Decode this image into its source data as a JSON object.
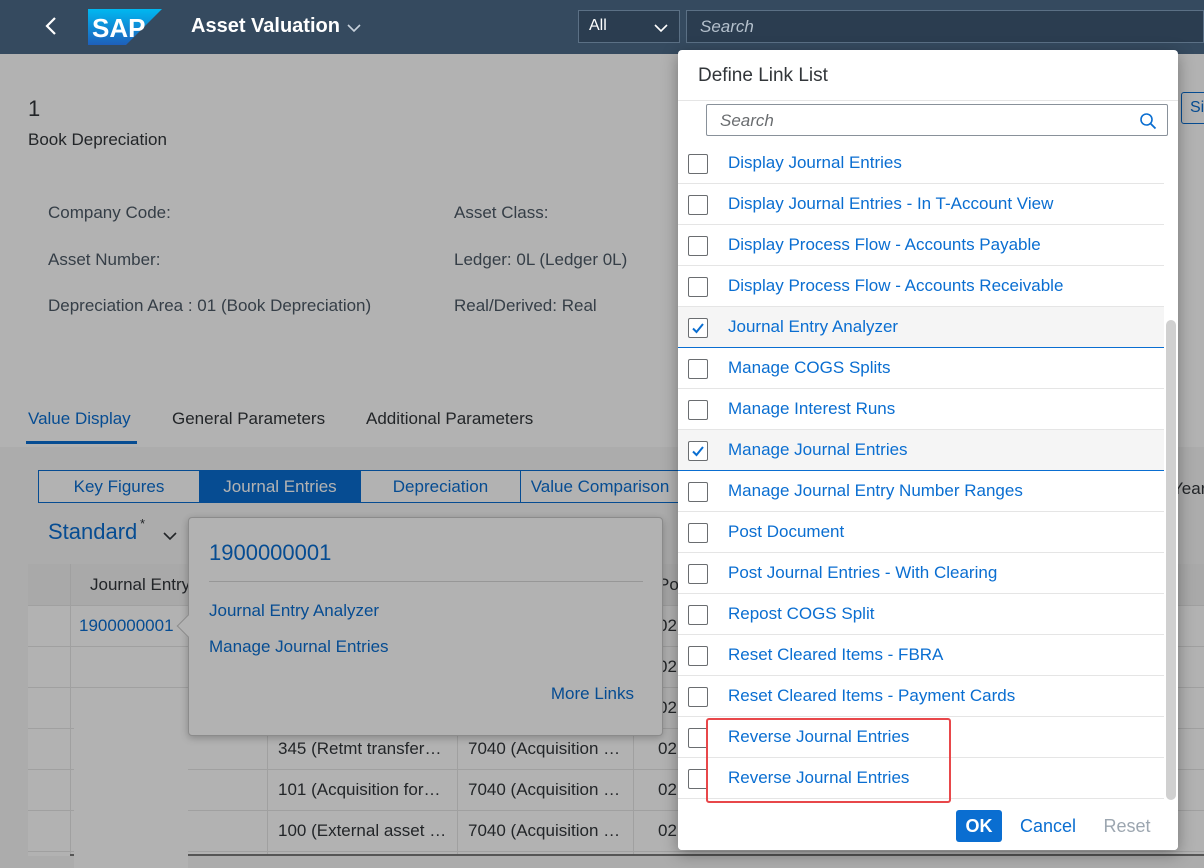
{
  "shell": {
    "back_icon": "chevron-left-icon",
    "logo_text": "SAP",
    "app_title": "Asset Valuation",
    "scope_value": "All",
    "search_placeholder": "Search",
    "colors": {
      "shell_bg": "#354a5f",
      "accent": "#0a6ed1"
    }
  },
  "header": {
    "object_number": "1",
    "object_subtitle": "Book Depreciation",
    "attributes": {
      "company_code": "Company Code:",
      "asset_class": "Asset Class:",
      "asset_number": "Asset Number:",
      "ledger": "Ledger: 0L (Ledger 0L)",
      "depreciation_area": "Depreciation Area : 01 (Book Depreciation)",
      "real_derived": "Real/Derived: Real"
    },
    "tabs": [
      "Value Display",
      "General Parameters",
      "Additional Parameters"
    ],
    "truncated_button": "Si"
  },
  "content": {
    "segments": [
      "Key Figures",
      "Journal Entries",
      "Depreciation",
      "Value Comparison"
    ],
    "segment_active": "Journal Entries",
    "trailing_label": "Year",
    "variant": "Standard",
    "variant_modified": "*",
    "table": {
      "headers": [
        "Journal Entry",
        "Po"
      ],
      "rows": [
        {
          "journal_entry": "1900000001",
          "c2": "",
          "c3": "",
          "c4": "02"
        },
        {
          "journal_entry": "",
          "c2": "",
          "c3": "",
          "c4": "02"
        },
        {
          "journal_entry": "",
          "c2": "",
          "c3": "",
          "c4": "02"
        },
        {
          "journal_entry": "",
          "c2": "345 (Retmt transfer…",
          "c3": "7040 (Acquisition …",
          "c4": "02"
        },
        {
          "journal_entry": "",
          "c2": "101 (Acquisition for…",
          "c3": "7040 (Acquisition …",
          "c4": "02"
        },
        {
          "journal_entry": "",
          "c2": "100 (External asset …",
          "c3": "7040 (Acquisition …",
          "c4": "02"
        }
      ]
    }
  },
  "popover": {
    "title": "1900000001",
    "links": [
      "Journal Entry Analyzer",
      "Manage Journal Entries"
    ],
    "more_links": "More Links"
  },
  "dialog": {
    "title": "Define Link List",
    "search_placeholder": "Search",
    "items": [
      {
        "label": "Display Journal Entries",
        "checked": false
      },
      {
        "label": "Display Journal Entries - In T-Account View",
        "checked": false
      },
      {
        "label": "Display Process Flow - Accounts Payable",
        "checked": false
      },
      {
        "label": "Display Process Flow - Accounts Receivable",
        "checked": false
      },
      {
        "label": "Journal Entry Analyzer",
        "checked": true
      },
      {
        "label": "Manage COGS Splits",
        "checked": false
      },
      {
        "label": "Manage Interest Runs",
        "checked": false
      },
      {
        "label": "Manage Journal Entries",
        "checked": true
      },
      {
        "label": "Manage Journal Entry Number Ranges",
        "checked": false
      },
      {
        "label": "Post Document",
        "checked": false
      },
      {
        "label": "Post Journal Entries - With Clearing",
        "checked": false
      },
      {
        "label": "Repost COGS Split",
        "checked": false
      },
      {
        "label": "Reset Cleared Items - FBRA",
        "checked": false
      },
      {
        "label": "Reset Cleared Items - Payment Cards",
        "checked": false
      },
      {
        "label": "Reverse Journal Entries",
        "checked": false
      },
      {
        "label": "Reverse Journal Entries",
        "checked": false
      }
    ],
    "ok_label": "OK",
    "cancel_label": "Cancel",
    "reset_label": "Reset",
    "highlight_color": "#e8474a"
  }
}
